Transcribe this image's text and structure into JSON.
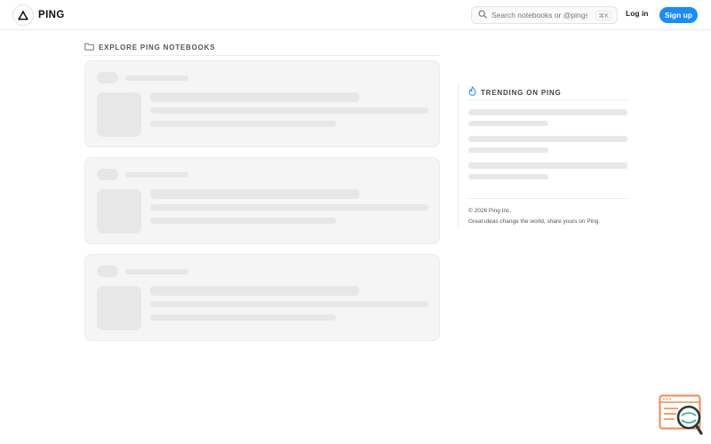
{
  "header": {
    "brand_name": "PING",
    "search_placeholder": "Search notebooks or @pings...",
    "search_shortcut": "⌘K",
    "login_label": "Log in",
    "signup_label": "Sign up"
  },
  "feed": {
    "section_title": "EXPLORE PING NOTEBOOKS",
    "loading_cards": 3
  },
  "sidebar": {
    "trending_title": "TRENDING ON PING",
    "loading_items": 3,
    "copyright": "© 2026 Ping Inc.",
    "tagline": "Great ideas change the world, share yours on Ping."
  },
  "icons": {
    "logo": "triangle-logo-icon",
    "search": "search-icon",
    "folder": "folder-icon",
    "trending": "flame-icon",
    "helper": "notebook-search-icon"
  },
  "colors": {
    "accent": "#1a8cff",
    "trending": "#1a8cff",
    "helper": "#f08a4b",
    "skeleton": "#e7e7e7",
    "card_bg": "#f5f5f5"
  }
}
